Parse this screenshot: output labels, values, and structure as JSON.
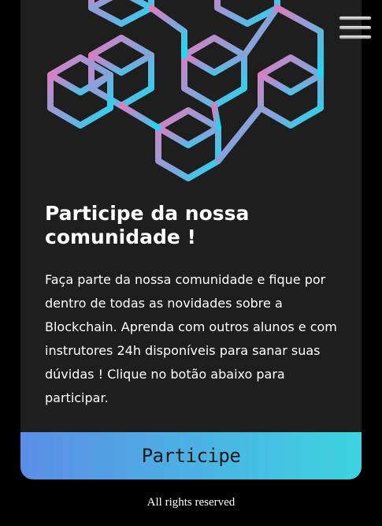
{
  "hero": {
    "illustration": "blockchain-cubes-icon",
    "gradient_start": "#e07bc0",
    "gradient_end": "#1ed9f0"
  },
  "card": {
    "title": "Participe da nossa comunidade !",
    "description": "Faça parte da nossa comunidade e fique por dentro de todas as novidades sobre a Blockchain. Aprenda com outros alunos e com instrutores 24h disponíveis para sanar suas dúvidas ! Clique no botão abaixo para participar.",
    "button_label": "Participe",
    "button_gradient_start": "#5b8ee6",
    "button_gradient_end": "#3dd4e0"
  },
  "menu": {
    "icon": "hamburger-menu-icon"
  },
  "footer": {
    "text": "All rights reserved"
  }
}
